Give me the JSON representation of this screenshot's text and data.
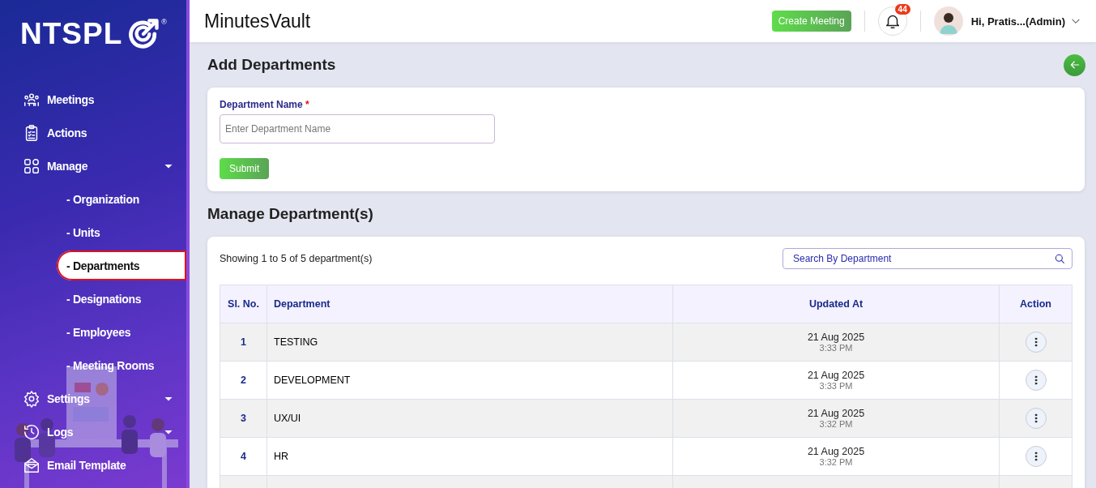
{
  "sidebar": {
    "logo": "NTSPL",
    "logo_mark": "®",
    "items": [
      {
        "label": "Meetings",
        "kind": "link"
      },
      {
        "label": "Actions",
        "kind": "link"
      },
      {
        "label": "Manage",
        "kind": "dropdown",
        "expanded": true,
        "children": [
          {
            "label": "- Organization",
            "selected": false
          },
          {
            "label": "- Units",
            "selected": false
          },
          {
            "label": "- Departments",
            "selected": true
          },
          {
            "label": "- Designations",
            "selected": false
          },
          {
            "label": "- Employees",
            "selected": false
          },
          {
            "label": "- Meeting Rooms",
            "selected": false
          }
        ]
      },
      {
        "label": "Settings",
        "kind": "dropdown"
      },
      {
        "label": "Logs",
        "kind": "dropdown"
      },
      {
        "label": "Email Template",
        "kind": "link"
      }
    ]
  },
  "header": {
    "title": "MinutesVault",
    "create_button": "Create Meeting",
    "notification_count": "44",
    "user": "Hi, Pratis...(Admin)"
  },
  "add_section": {
    "title": "Add Departments",
    "field_label": "Department Name",
    "required_mark": "*",
    "placeholder": "Enter Department Name",
    "submit": "Submit"
  },
  "manage_section": {
    "title": "Manage Department(s)",
    "summary": "Showing 1 to 5 of 5 department(s)",
    "search_placeholder": "Search By Department",
    "table": {
      "columns": [
        "Sl. No.",
        "Department",
        "Updated At",
        "Action"
      ],
      "rows": [
        {
          "no": "1",
          "department": "TESTING",
          "date": "21 Aug 2025",
          "time": "3:33 PM"
        },
        {
          "no": "2",
          "department": "DEVELOPMENT",
          "date": "21 Aug 2025",
          "time": "3:33 PM"
        },
        {
          "no": "3",
          "department": "UX/UI",
          "date": "21 Aug 2025",
          "time": "3:32 PM"
        },
        {
          "no": "4",
          "department": "HR",
          "date": "21 Aug 2025",
          "time": "3:32 PM"
        }
      ]
    }
  }
}
